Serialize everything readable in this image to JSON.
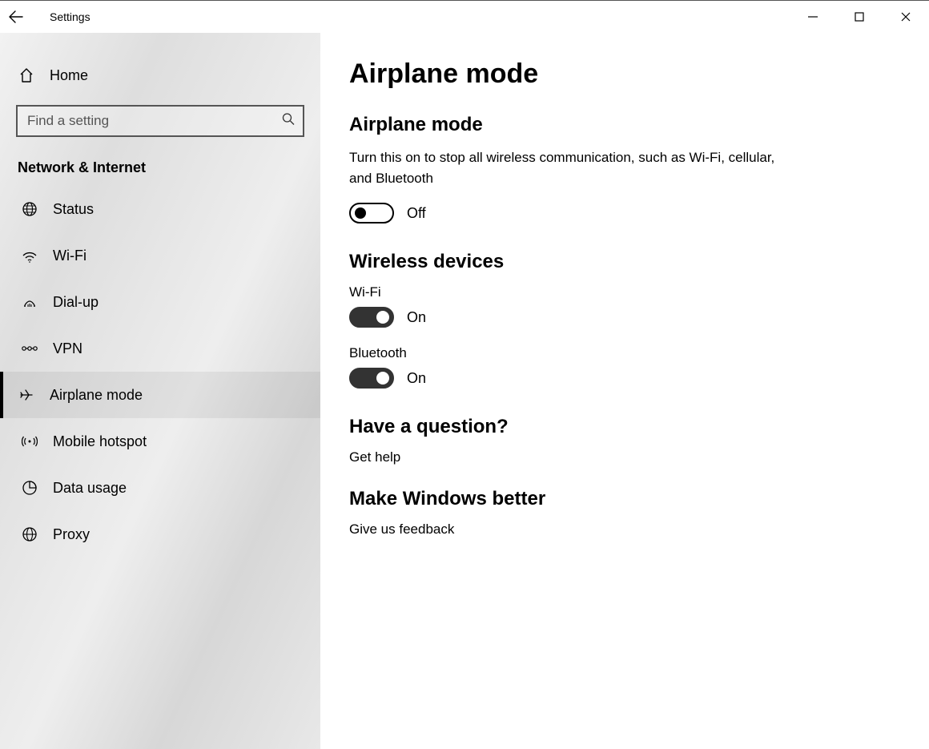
{
  "titlebar": {
    "app_title": "Settings"
  },
  "sidebar": {
    "home_label": "Home",
    "search_placeholder": "Find a setting",
    "section_title": "Network & Internet",
    "items": [
      {
        "label": "Status"
      },
      {
        "label": "Wi-Fi"
      },
      {
        "label": "Dial-up"
      },
      {
        "label": "VPN"
      },
      {
        "label": "Airplane mode"
      },
      {
        "label": "Mobile hotspot"
      },
      {
        "label": "Data usage"
      },
      {
        "label": "Proxy"
      }
    ],
    "active_index": 4
  },
  "main": {
    "page_title": "Airplane mode",
    "sections": {
      "airplane": {
        "heading": "Airplane mode",
        "description": "Turn this on to stop all wireless communication, such as Wi-Fi, cellular, and Bluetooth",
        "toggle": {
          "state": "off",
          "label": "Off"
        }
      },
      "wireless": {
        "heading": "Wireless devices",
        "devices": [
          {
            "name": "Wi-Fi",
            "state": "on",
            "label": "On"
          },
          {
            "name": "Bluetooth",
            "state": "on",
            "label": "On"
          }
        ]
      },
      "question": {
        "heading": "Have a question?",
        "link": "Get help"
      },
      "feedback": {
        "heading": "Make Windows better",
        "link": "Give us feedback"
      }
    }
  }
}
